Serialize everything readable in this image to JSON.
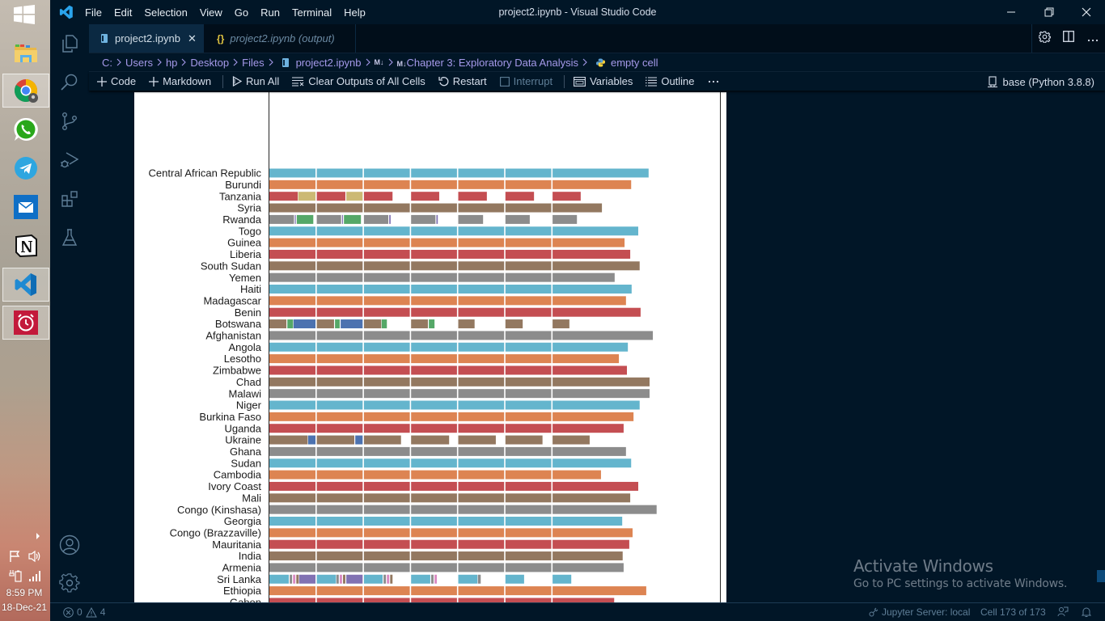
{
  "taskbar": {
    "apps": [
      {
        "name": "File Explorer",
        "open": false
      },
      {
        "name": "Google Chrome",
        "open": true
      },
      {
        "name": "WhatsApp",
        "open": false
      },
      {
        "name": "Telegram",
        "open": false
      },
      {
        "name": "Mail",
        "open": false
      },
      {
        "name": "Notion",
        "open": false
      },
      {
        "name": "Visual Studio Code",
        "open": true
      },
      {
        "name": "Alarms & Clock",
        "open": true
      }
    ],
    "clock": {
      "time": "8:59 PM",
      "date": "18-Dec-21"
    }
  },
  "titlebar": {
    "menus": [
      "File",
      "Edit",
      "Selection",
      "View",
      "Go",
      "Run",
      "Terminal",
      "Help"
    ],
    "title": "project2.ipynb - Visual Studio Code"
  },
  "tabs": [
    {
      "label": "project2.ipynb",
      "active": true
    },
    {
      "label": "project2.ipynb (output)",
      "active": false
    }
  ],
  "breadcrumb": {
    "items": [
      "C:",
      "Users",
      "hp",
      "Desktop",
      "Files",
      "project2.ipynb",
      "Chapter 3: Exploratory Data Analysis",
      "empty cell"
    ]
  },
  "toolbar": {
    "add_code": "Code",
    "add_markdown": "Markdown",
    "run_all": "Run All",
    "clear_outputs": "Clear Outputs of All Cells",
    "restart": "Restart",
    "interrupt": "Interrupt",
    "variables": "Variables",
    "outline": "Outline",
    "kernel": "base (Python 3.8.8)"
  },
  "statusbar": {
    "errors": "0",
    "warnings": "4",
    "jupyter": "Jupyter Server: local",
    "cell": "Cell 173 of 173"
  },
  "watermark": {
    "title": "Activate Windows",
    "subtitle": "Go to PC settings to activate Windows."
  },
  "theme": {
    "background": "#011627",
    "breadcrumb_text": "#a599e9",
    "active_tab": "#0b2942"
  },
  "chart_data": {
    "type": "bar",
    "orientation": "horizontal",
    "stacked": true,
    "title": "",
    "xlabel": "",
    "ylabel": "",
    "xlim": [
      0,
      9.56
    ],
    "grid_x": [
      1,
      2,
      3,
      4,
      5,
      6
    ],
    "legend": "none",
    "palette": {
      "blue": "#4c72b0",
      "orange": "#dd8452",
      "green": "#55a868",
      "red": "#c44e52",
      "purple": "#8172b3",
      "brown": "#937860",
      "pink": "#da8bc3",
      "gray": "#8c8c8c",
      "yellow": "#ccb974",
      "teal": "#64b5cd"
    },
    "rows": [
      {
        "label": "Central African Republic",
        "segments": [
          [
            0,
            8.05,
            "teal"
          ]
        ]
      },
      {
        "label": "Burundi",
        "segments": [
          [
            0,
            7.68,
            "orange"
          ]
        ]
      },
      {
        "label": "Tanzania",
        "segments": [
          [
            0,
            0.61,
            "red"
          ],
          [
            0.62,
            1.0,
            "yellow"
          ],
          [
            1.0,
            1.62,
            "red"
          ],
          [
            1.64,
            2.0,
            "yellow"
          ],
          [
            2.0,
            2.62,
            "red"
          ],
          [
            3.0,
            3.61,
            "red"
          ],
          [
            4.0,
            4.62,
            "red"
          ],
          [
            5.0,
            5.62,
            "red"
          ],
          [
            6.0,
            6.61,
            "red"
          ]
        ]
      },
      {
        "label": "Syria",
        "segments": [
          [
            0,
            7.06,
            "brown"
          ]
        ]
      },
      {
        "label": "Rwanda",
        "segments": [
          [
            0,
            0.53,
            "gray"
          ],
          [
            0.55,
            0.57,
            "purple"
          ],
          [
            0.59,
            0.94,
            "green"
          ],
          [
            1.0,
            1.53,
            "gray"
          ],
          [
            1.55,
            1.57,
            "purple"
          ],
          [
            1.59,
            1.95,
            "green"
          ],
          [
            2.0,
            2.53,
            "gray"
          ],
          [
            2.55,
            2.58,
            "purple"
          ],
          [
            3.0,
            3.53,
            "gray"
          ],
          [
            3.55,
            3.58,
            "purple"
          ],
          [
            4.0,
            4.54,
            "gray"
          ],
          [
            5.0,
            5.53,
            "gray"
          ],
          [
            6.0,
            6.53,
            "gray"
          ]
        ]
      },
      {
        "label": "Togo",
        "segments": [
          [
            0,
            7.83,
            "teal"
          ]
        ]
      },
      {
        "label": "Guinea",
        "segments": [
          [
            0,
            7.54,
            "orange"
          ]
        ]
      },
      {
        "label": "Liberia",
        "segments": [
          [
            0,
            7.66,
            "red"
          ]
        ]
      },
      {
        "label": "South Sudan",
        "segments": [
          [
            0,
            7.86,
            "brown"
          ]
        ]
      },
      {
        "label": "Yemen",
        "segments": [
          [
            0,
            7.33,
            "gray"
          ]
        ]
      },
      {
        "label": "Haiti",
        "segments": [
          [
            0,
            7.69,
            "teal"
          ]
        ]
      },
      {
        "label": "Madagascar",
        "segments": [
          [
            0,
            7.57,
            "orange"
          ]
        ]
      },
      {
        "label": "Benin",
        "segments": [
          [
            0,
            7.88,
            "red"
          ]
        ]
      },
      {
        "label": "Botswana",
        "segments": [
          [
            0,
            0.37,
            "brown"
          ],
          [
            0.39,
            0.51,
            "green"
          ],
          [
            0.52,
            0.99,
            "blue"
          ],
          [
            1.0,
            1.38,
            "brown"
          ],
          [
            1.4,
            1.5,
            "green"
          ],
          [
            1.52,
            1.99,
            "blue"
          ],
          [
            2.0,
            2.38,
            "brown"
          ],
          [
            2.39,
            2.5,
            "green"
          ],
          [
            3.0,
            3.37,
            "brown"
          ],
          [
            3.39,
            3.51,
            "green"
          ],
          [
            4.0,
            4.36,
            "brown"
          ],
          [
            5.0,
            5.38,
            "brown"
          ],
          [
            6.0,
            6.37,
            "brown"
          ]
        ]
      },
      {
        "label": "Afghanistan",
        "segments": [
          [
            0,
            8.14,
            "gray"
          ]
        ]
      },
      {
        "label": "Angola",
        "segments": [
          [
            0,
            7.61,
            "teal"
          ]
        ]
      },
      {
        "label": "Lesotho",
        "segments": [
          [
            0,
            7.42,
            "orange"
          ]
        ]
      },
      {
        "label": "Zimbabwe",
        "segments": [
          [
            0,
            7.59,
            "red"
          ]
        ]
      },
      {
        "label": "Chad",
        "segments": [
          [
            0,
            8.07,
            "brown"
          ]
        ]
      },
      {
        "label": "Malawi",
        "segments": [
          [
            0,
            8.07,
            "gray"
          ]
        ]
      },
      {
        "label": "Niger",
        "segments": [
          [
            0,
            7.86,
            "teal"
          ]
        ]
      },
      {
        "label": "Burkina Faso",
        "segments": [
          [
            0,
            7.73,
            "orange"
          ]
        ]
      },
      {
        "label": "Uganda",
        "segments": [
          [
            0,
            7.52,
            "red"
          ]
        ]
      },
      {
        "label": "Ukraine",
        "segments": [
          [
            0,
            0.82,
            "brown"
          ],
          [
            0.83,
            0.99,
            "blue"
          ],
          [
            1.0,
            1.81,
            "brown"
          ],
          [
            1.83,
            1.99,
            "blue"
          ],
          [
            2.0,
            2.8,
            "brown"
          ],
          [
            3.0,
            3.82,
            "brown"
          ],
          [
            4.0,
            4.81,
            "brown"
          ],
          [
            5.0,
            5.8,
            "brown"
          ],
          [
            6.0,
            6.8,
            "brown"
          ]
        ]
      },
      {
        "label": "Ghana",
        "segments": [
          [
            0,
            7.57,
            "gray"
          ]
        ]
      },
      {
        "label": "Sudan",
        "segments": [
          [
            0,
            7.68,
            "teal"
          ]
        ]
      },
      {
        "label": "Cambodia",
        "segments": [
          [
            0,
            7.04,
            "orange"
          ]
        ]
      },
      {
        "label": "Ivory Coast",
        "segments": [
          [
            0,
            7.83,
            "red"
          ]
        ]
      },
      {
        "label": "Mali",
        "segments": [
          [
            0,
            7.66,
            "brown"
          ]
        ]
      },
      {
        "label": "Congo (Kinshasa)",
        "segments": [
          [
            0,
            8.22,
            "gray"
          ]
        ]
      },
      {
        "label": "Georgia",
        "segments": [
          [
            0,
            7.49,
            "teal"
          ]
        ]
      },
      {
        "label": "Congo (Brazzaville)",
        "segments": [
          [
            0,
            7.71,
            "orange"
          ]
        ]
      },
      {
        "label": "Mauritania",
        "segments": [
          [
            0,
            7.64,
            "red"
          ]
        ]
      },
      {
        "label": "India",
        "segments": [
          [
            0,
            7.5,
            "brown"
          ]
        ]
      },
      {
        "label": "Armenia",
        "segments": [
          [
            0,
            7.52,
            "gray"
          ]
        ]
      },
      {
        "label": "Sri Lanka",
        "segments": [
          [
            0,
            0.42,
            "teal"
          ],
          [
            0.44,
            0.49,
            "gray"
          ],
          [
            0.51,
            0.56,
            "pink"
          ],
          [
            0.58,
            0.63,
            "brown"
          ],
          [
            0.64,
            0.99,
            "purple"
          ],
          [
            1.0,
            1.42,
            "teal"
          ],
          [
            1.43,
            1.48,
            "gray"
          ],
          [
            1.5,
            1.55,
            "pink"
          ],
          [
            1.57,
            1.62,
            "brown"
          ],
          [
            1.64,
            1.99,
            "purple"
          ],
          [
            2.0,
            2.41,
            "teal"
          ],
          [
            2.43,
            2.48,
            "gray"
          ],
          [
            2.5,
            2.55,
            "pink"
          ],
          [
            2.57,
            2.62,
            "brown"
          ],
          [
            3.0,
            3.42,
            "teal"
          ],
          [
            3.44,
            3.49,
            "gray"
          ],
          [
            3.51,
            3.56,
            "pink"
          ],
          [
            4.0,
            4.42,
            "teal"
          ],
          [
            4.43,
            4.49,
            "gray"
          ],
          [
            5.0,
            5.41,
            "teal"
          ],
          [
            6.0,
            6.41,
            "teal"
          ]
        ]
      },
      {
        "label": "Ethiopia",
        "segments": [
          [
            0,
            8.0,
            "orange"
          ]
        ]
      },
      {
        "label": "Gabon",
        "segments": [
          [
            0,
            7.32,
            "red"
          ]
        ]
      }
    ]
  }
}
